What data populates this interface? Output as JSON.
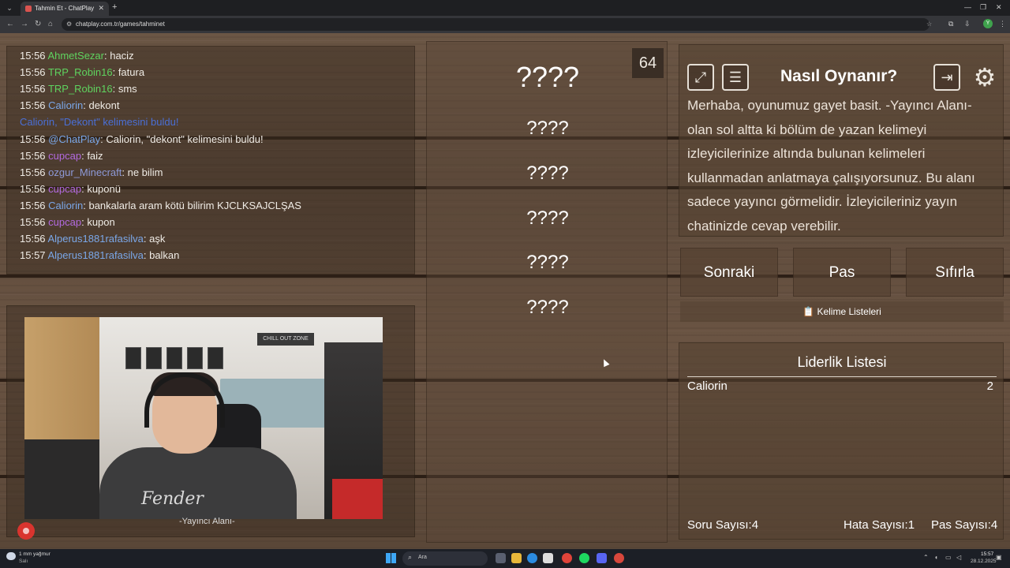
{
  "browser": {
    "tab_title": "Tahmin Et - ChatPlay",
    "url": "chatplay.com.tr/games/tahminet",
    "profile_initial": "Y"
  },
  "chat": {
    "messages": [
      {
        "time": "15:56",
        "user": "AhmetSezar",
        "text": ": haciz",
        "color": "#5fd35f"
      },
      {
        "time": "15:56",
        "user": "TRP_Robin16",
        "text": ": fatura",
        "color": "#5fd35f"
      },
      {
        "time": "15:56",
        "user": "TRP_Robin16",
        "text": ": sms",
        "color": "#5fd35f"
      },
      {
        "time": "15:56",
        "user": "Caliorin",
        "text": ": dekont",
        "color": "#7aa7e8"
      },
      {
        "system": "Caliorin, \"Dekont\" kelimesini buldu!"
      },
      {
        "time": "15:56",
        "user": "@ChatPlay",
        "text": ": Caliorin, \"dekont\" kelimesini buldu!",
        "color": "#7aa7e8"
      },
      {
        "time": "15:56",
        "user": "cupcap",
        "text": ": faiz",
        "color": "#b36ae0"
      },
      {
        "time": "15:56",
        "user": "ozgur_Minecraft",
        "text": ": ne bilim",
        "color": "#8e9ad8"
      },
      {
        "time": "15:56",
        "user": "cupcap",
        "text": ": kuponü",
        "color": "#b36ae0"
      },
      {
        "time": "15:56",
        "user": "Caliorin",
        "text": ": bankalarla aram kötü bilirim KJCLKSAJCLŞAS",
        "color": "#7aa7e8"
      },
      {
        "time": "15:56",
        "user": "cupcap",
        "text": ": kupon",
        "color": "#b36ae0"
      },
      {
        "time": "15:56",
        "user": "Alperus1881rafasilva",
        "text": ": aşk",
        "color": "#7aa7e8"
      },
      {
        "time": "15:57",
        "user": "Alperus1881rafasilva",
        "text": ": balkan",
        "color": "#7aa7e8"
      }
    ]
  },
  "streamer": {
    "label": "-Yayıncı Alanı-",
    "webcam_sign": "CHILL OUT ZONE",
    "shirt_logo": "Fender"
  },
  "game": {
    "timer": "64",
    "words": [
      "????",
      "????",
      "????",
      "????",
      "????",
      "????"
    ]
  },
  "howto": {
    "title": "Nasıl Oynanır?",
    "text": "Merhaba, oyunumuz gayet basit. -Yayıncı Alanı- olan sol altta ki bölüm de yazan kelimeyi izleyicilerinize altında bulunan kelimeleri kullanmadan anlatmaya çalışıyorsunuz. Bu alanı sadece yayıncı görmelidir. İzleyicileriniz yayın chatinizde cevap verebilir."
  },
  "actions": {
    "next": "Sonraki",
    "pass": "Pas",
    "reset": "Sıfırla",
    "word_lists": "Kelime Listeleri"
  },
  "leaderboard": {
    "title": "Liderlik Listesi",
    "entries": [
      {
        "name": "Caliorin",
        "score": "2"
      }
    ],
    "question_count": "Soru Sayısı:4",
    "error_count": "Hata Sayısı:1",
    "pass_count": "Pas Sayısı:4"
  },
  "taskbar": {
    "weather_temp": "1 mm yağmur",
    "weather_sub": "Salı",
    "search_placeholder": "Ara",
    "time": "15:57",
    "date": "28.12.2025"
  }
}
